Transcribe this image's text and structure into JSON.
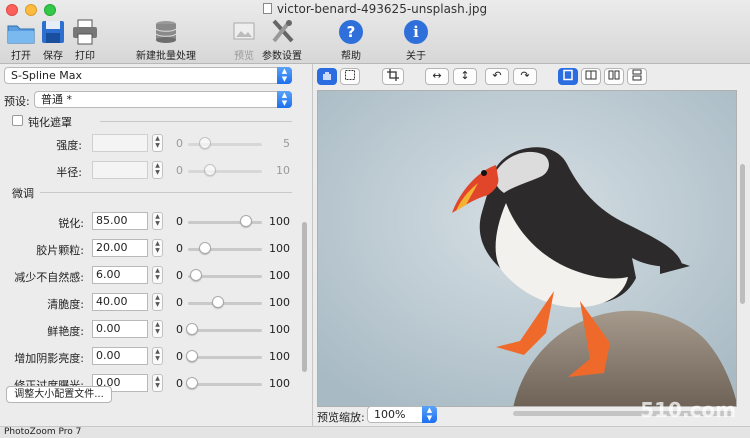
{
  "window": {
    "title": "victor-benard-493625-unsplash.jpg",
    "app_name": "PhotoZoom Pro 7"
  },
  "toolbar": {
    "open": "打开",
    "save": "保存",
    "print": "打印",
    "batch": "新建批量处理",
    "preview": "预览",
    "settings": "参数设置",
    "help": "帮助",
    "about": "关于"
  },
  "left": {
    "method": "S-Spline Max",
    "preset_label": "预设:",
    "preset_value": "普通 *",
    "unsharp_label": "钝化遮罩",
    "strength_label": "强度:",
    "strength_min": "0",
    "strength_max": "5",
    "radius_label": "半径:",
    "radius_min": "0",
    "radius_max": "10",
    "finetune_label": "微调",
    "rows": [
      {
        "label": "锐化:",
        "value": "85.00",
        "min": "0",
        "max": "100",
        "level": 0.85
      },
      {
        "label": "胶片颗粒:",
        "value": "20.00",
        "min": "0",
        "max": "100",
        "level": 0.2
      },
      {
        "label": "减少不自然感:",
        "value": "6.00",
        "min": "0",
        "max": "100",
        "level": 0.06
      },
      {
        "label": "清脆度:",
        "value": "40.00",
        "min": "0",
        "max": "100",
        "level": 0.4
      },
      {
        "label": "鲜艳度:",
        "value": "0.00",
        "min": "0",
        "max": "100",
        "level": 0
      },
      {
        "label": "增加阴影亮度:",
        "value": "0.00",
        "min": "0",
        "max": "100",
        "level": 0
      },
      {
        "label": "修正过度曝光:",
        "value": "0.00",
        "min": "0",
        "max": "100",
        "level": 0
      }
    ],
    "resize_button": "调整大小配置文件..."
  },
  "preview": {
    "zoom_label": "预览缩放:",
    "zoom_value": "100%"
  },
  "watermark": "510.com"
}
